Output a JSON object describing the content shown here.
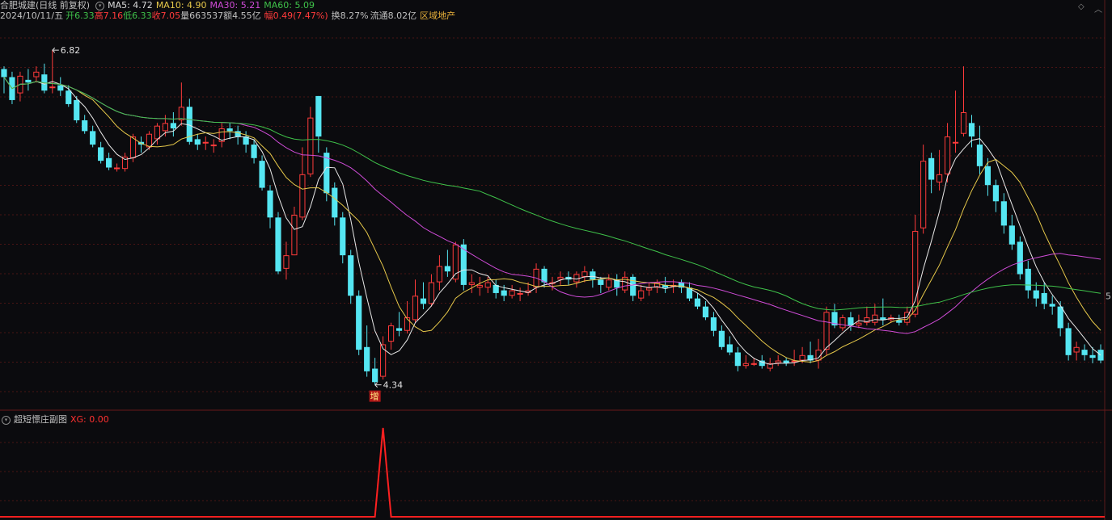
{
  "header": {
    "stock_name": "合肥城建(日线 前复权)",
    "ma5": "MA5: 4.72",
    "ma10": "MA10: 4.90",
    "ma30": "MA30: 5.21",
    "ma60": "MA60: 5.09",
    "date": "2024/10/11/五",
    "open": "开6.33",
    "high": "高7.16",
    "low": "低6.33",
    "close": "收7.05",
    "volume": "量663537",
    "amount": "额4.55亿",
    "change": "幅0.49(7.47%)",
    "turnover": "换8.27%",
    "float": "流通8.02亿",
    "sector": "区域地产"
  },
  "sub_panel": {
    "title": "超短慓庄副图",
    "xg_label": "XG: 0.00"
  },
  "colors": {
    "up": "#ff3b3b",
    "down": "#55e6f2",
    "ma5": "#e8e8e8",
    "ma10": "#e6c84a",
    "ma30": "#d04cd8",
    "ma60": "#3fc24a",
    "xg": "#ff2020",
    "grid": "#4a1414"
  },
  "chart_data": [
    {
      "type": "candlestick",
      "title": "合肥城建(日线 前复权)",
      "y_range": [
        4.2,
        7.0
      ],
      "right_axis_label": "5",
      "annotations": [
        {
          "text": "6.82",
          "kind": "max"
        },
        {
          "text": "4.34",
          "kind": "min"
        },
        {
          "text": "增",
          "kind": "signal"
        }
      ],
      "candles": [
        [
          6.68,
          6.62,
          6.7,
          6.5
        ],
        [
          6.62,
          6.45,
          6.66,
          6.42
        ],
        [
          6.5,
          6.63,
          6.66,
          6.44
        ],
        [
          6.6,
          6.58,
          6.68,
          6.52
        ],
        [
          6.62,
          6.66,
          6.7,
          6.58
        ],
        [
          6.64,
          6.52,
          6.72,
          6.5
        ],
        [
          6.55,
          6.55,
          6.82,
          6.5
        ],
        [
          6.56,
          6.52,
          6.62,
          6.48
        ],
        [
          6.52,
          6.42,
          6.56,
          6.4
        ],
        [
          6.45,
          6.3,
          6.48,
          6.28
        ],
        [
          6.3,
          6.22,
          6.34,
          6.2
        ],
        [
          6.22,
          6.12,
          6.26,
          6.1
        ],
        [
          6.1,
          6.0,
          6.14,
          5.98
        ],
        [
          6.02,
          5.95,
          6.06,
          5.93
        ],
        [
          5.95,
          5.95,
          5.98,
          5.92
        ],
        [
          5.94,
          6.03,
          6.06,
          5.92
        ],
        [
          6.02,
          6.18,
          6.2,
          5.99
        ],
        [
          6.14,
          6.12,
          6.18,
          6.06
        ],
        [
          6.1,
          6.2,
          6.22,
          6.08
        ],
        [
          6.16,
          6.26,
          6.28,
          6.12
        ],
        [
          6.22,
          6.28,
          6.34,
          6.18
        ],
        [
          6.28,
          6.24,
          6.36,
          6.18
        ],
        [
          6.3,
          6.4,
          6.58,
          6.26
        ],
        [
          6.4,
          6.14,
          6.46,
          6.12
        ],
        [
          6.16,
          6.12,
          6.2,
          6.08
        ],
        [
          6.14,
          6.14,
          6.18,
          6.08
        ],
        [
          6.12,
          6.12,
          6.16,
          6.06
        ],
        [
          6.14,
          6.24,
          6.28,
          6.1
        ],
        [
          6.24,
          6.22,
          6.28,
          6.16
        ],
        [
          6.22,
          6.18,
          6.26,
          6.12
        ],
        [
          6.18,
          6.12,
          6.22,
          6.06
        ],
        [
          6.12,
          6.02,
          6.16,
          5.98
        ],
        [
          6.0,
          5.8,
          6.04,
          5.78
        ],
        [
          5.78,
          5.58,
          5.82,
          5.5
        ],
        [
          5.58,
          5.18,
          5.62,
          5.16
        ],
        [
          5.2,
          5.3,
          5.4,
          5.12
        ],
        [
          5.3,
          5.6,
          5.66,
          5.3
        ],
        [
          5.58,
          5.9,
          6.1,
          5.56
        ],
        [
          5.9,
          6.32,
          6.4,
          5.88
        ],
        [
          6.48,
          6.18,
          6.48,
          6.06
        ],
        [
          6.06,
          5.76,
          6.1,
          5.7
        ],
        [
          5.8,
          5.58,
          5.84,
          5.52
        ],
        [
          5.58,
          5.3,
          5.62,
          5.24
        ],
        [
          5.3,
          5.0,
          5.34,
          4.94
        ],
        [
          5.0,
          4.6,
          5.04,
          4.56
        ],
        [
          4.62,
          4.44,
          4.78,
          4.4
        ],
        [
          4.46,
          4.36,
          4.54,
          4.34
        ],
        [
          4.4,
          4.64,
          4.7,
          4.38
        ],
        [
          4.66,
          4.78,
          4.8,
          4.6
        ],
        [
          4.76,
          4.74,
          4.88,
          4.7
        ],
        [
          4.74,
          4.84,
          4.96,
          4.72
        ],
        [
          4.82,
          5.0,
          5.12,
          4.8
        ],
        [
          4.98,
          4.94,
          5.1,
          4.9
        ],
        [
          4.94,
          5.1,
          5.16,
          4.92
        ],
        [
          5.1,
          5.22,
          5.3,
          5.04
        ],
        [
          5.22,
          5.18,
          5.34,
          5.14
        ],
        [
          5.12,
          5.38,
          5.4,
          5.1
        ],
        [
          5.38,
          5.08,
          5.42,
          5.04
        ],
        [
          5.08,
          5.1,
          5.16,
          5.02
        ],
        [
          5.06,
          5.08,
          5.14,
          5.0
        ],
        [
          5.06,
          5.1,
          5.14,
          5.02
        ],
        [
          5.08,
          5.02,
          5.12,
          4.98
        ],
        [
          5.04,
          5.0,
          5.08,
          4.96
        ],
        [
          5.0,
          5.04,
          5.08,
          4.98
        ],
        [
          5.02,
          5.02,
          5.06,
          4.96
        ],
        [
          5.02,
          5.04,
          5.1,
          5.0
        ],
        [
          5.06,
          5.2,
          5.24,
          5.02
        ],
        [
          5.2,
          5.1,
          5.22,
          5.06
        ],
        [
          5.1,
          5.1,
          5.14,
          5.04
        ],
        [
          5.12,
          5.14,
          5.18,
          5.08
        ],
        [
          5.14,
          5.12,
          5.18,
          5.08
        ],
        [
          5.1,
          5.16,
          5.18,
          5.06
        ],
        [
          5.14,
          5.18,
          5.22,
          5.1
        ],
        [
          5.18,
          5.12,
          5.2,
          5.06
        ],
        [
          5.12,
          5.08,
          5.14,
          5.02
        ],
        [
          5.06,
          5.12,
          5.16,
          5.04
        ],
        [
          5.12,
          5.06,
          5.16,
          5.0
        ],
        [
          5.04,
          5.14,
          5.18,
          5.02
        ],
        [
          5.14,
          5.0,
          5.16,
          4.96
        ],
        [
          4.98,
          5.04,
          5.08,
          4.96
        ],
        [
          5.04,
          5.06,
          5.1,
          5.0
        ],
        [
          5.06,
          5.1,
          5.12,
          5.02
        ],
        [
          5.08,
          5.06,
          5.14,
          5.02
        ],
        [
          5.08,
          5.08,
          5.12,
          5.02
        ],
        [
          5.1,
          5.06,
          5.12,
          5.02
        ],
        [
          5.06,
          4.98,
          5.1,
          4.96
        ],
        [
          4.98,
          4.92,
          5.02,
          4.9
        ],
        [
          4.92,
          4.84,
          4.96,
          4.82
        ],
        [
          4.84,
          4.74,
          4.88,
          4.7
        ],
        [
          4.74,
          4.62,
          4.78,
          4.6
        ],
        [
          4.64,
          4.58,
          4.7,
          4.56
        ],
        [
          4.58,
          4.48,
          4.62,
          4.44
        ],
        [
          4.48,
          4.5,
          4.56,
          4.46
        ],
        [
          4.5,
          4.5,
          4.54,
          4.48
        ],
        [
          4.52,
          4.48,
          4.56,
          4.46
        ],
        [
          4.46,
          4.5,
          4.54,
          4.44
        ],
        [
          4.5,
          4.52,
          4.56,
          4.48
        ],
        [
          4.52,
          4.5,
          4.54,
          4.48
        ],
        [
          4.52,
          4.52,
          4.6,
          4.48
        ],
        [
          4.52,
          4.56,
          4.62,
          4.5
        ],
        [
          4.56,
          4.52,
          4.66,
          4.5
        ],
        [
          4.52,
          4.6,
          4.68,
          4.46
        ],
        [
          4.6,
          4.88,
          4.92,
          4.56
        ],
        [
          4.88,
          4.78,
          4.94,
          4.76
        ],
        [
          4.76,
          4.84,
          4.86,
          4.74
        ],
        [
          4.84,
          4.78,
          4.88,
          4.74
        ],
        [
          4.78,
          4.8,
          4.86,
          4.76
        ],
        [
          4.8,
          4.84,
          4.92,
          4.78
        ],
        [
          4.8,
          4.86,
          4.94,
          4.78
        ],
        [
          4.84,
          4.82,
          4.98,
          4.78
        ],
        [
          4.82,
          4.84,
          4.86,
          4.8
        ],
        [
          4.82,
          4.8,
          4.86,
          4.78
        ],
        [
          4.8,
          4.88,
          4.92,
          4.78
        ],
        [
          4.86,
          5.48,
          5.6,
          4.84
        ],
        [
          5.5,
          6.0,
          6.12,
          5.46
        ],
        [
          6.02,
          5.86,
          6.06,
          5.76
        ],
        [
          5.84,
          5.9,
          6.08,
          5.78
        ],
        [
          5.9,
          6.18,
          6.28,
          5.84
        ],
        [
          6.14,
          6.14,
          6.52,
          6.06
        ],
        [
          6.2,
          6.36,
          6.7,
          6.18
        ],
        [
          6.28,
          6.18,
          6.34,
          6.1
        ],
        [
          6.12,
          5.96,
          6.26,
          5.9
        ],
        [
          5.96,
          5.82,
          6.02,
          5.74
        ],
        [
          5.82,
          5.7,
          5.86,
          5.62
        ],
        [
          5.7,
          5.52,
          5.76,
          5.46
        ],
        [
          5.52,
          5.38,
          5.6,
          5.34
        ],
        [
          5.4,
          5.16,
          5.44,
          5.12
        ],
        [
          5.2,
          5.04,
          5.26,
          4.98
        ],
        [
          5.04,
          4.98,
          5.1,
          4.92
        ],
        [
          5.02,
          4.94,
          5.1,
          4.9
        ],
        [
          4.94,
          4.92,
          5.0,
          4.86
        ],
        [
          4.92,
          4.76,
          4.96,
          4.7
        ],
        [
          4.76,
          4.56,
          4.8,
          4.52
        ],
        [
          4.58,
          4.62,
          4.66,
          4.52
        ],
        [
          4.6,
          4.56,
          4.64,
          4.52
        ],
        [
          4.56,
          4.54,
          4.62,
          4.5
        ],
        [
          4.6,
          4.52,
          4.64,
          4.5
        ]
      ],
      "series": [
        {
          "name": "MA5",
          "values": []
        },
        {
          "name": "MA10",
          "values": []
        },
        {
          "name": "MA30",
          "values": []
        },
        {
          "name": "MA60",
          "values": []
        }
      ]
    },
    {
      "type": "line",
      "title": "超短慓庄副图",
      "series": [
        {
          "name": "XG",
          "spike_index": 47,
          "spike_value": 1,
          "base_value": 0
        }
      ]
    }
  ]
}
